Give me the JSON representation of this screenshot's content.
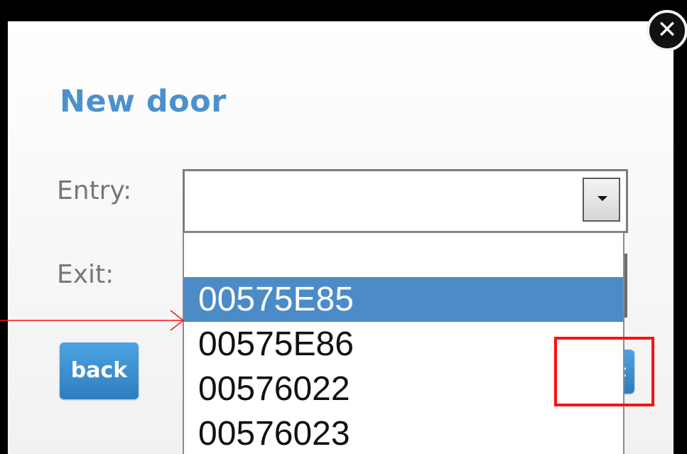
{
  "dialog": {
    "title": "New door",
    "close_glyph": "✕",
    "fields": {
      "entry_label": "Entry:",
      "entry_value": "",
      "exit_label": "Exit:"
    },
    "dropdown": {
      "options": [
        "",
        "00575E85",
        "00575E86",
        "00576022",
        "00576023"
      ],
      "selected": "00575E85"
    },
    "buttons": {
      "back": "back",
      "next": "next"
    }
  },
  "annotations": {
    "highlight_color": "#ff1010",
    "arrow_color": "#ff1010"
  },
  "colors": {
    "title": "#4c91cd",
    "button": "#3a8fd2",
    "selected_option": "#4b8bc8"
  }
}
